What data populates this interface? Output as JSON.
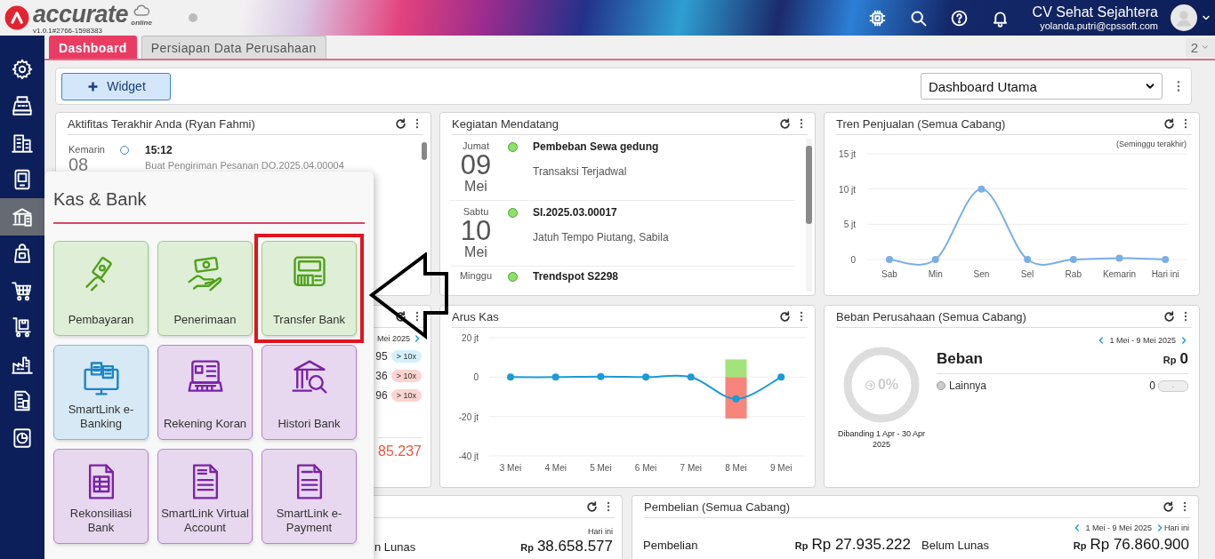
{
  "header": {
    "logo_text": "accurate",
    "logo_subtext": "online",
    "version": "v1.0.1#2766-1598383",
    "company": "CV Sehat Sejahtera",
    "email": "yolanda.putri@cpssoft.com"
  },
  "sidebar": {
    "items": [
      {
        "selected": false
      },
      {
        "selected": false
      },
      {
        "selected": false
      },
      {
        "selected": false
      },
      {
        "selected": true
      },
      {
        "selected": false
      },
      {
        "selected": false
      },
      {
        "selected": false
      },
      {
        "selected": false
      },
      {
        "selected": false
      },
      {
        "selected": false
      }
    ]
  },
  "tabs": [
    {
      "label": "Dashboard",
      "selected": true
    },
    {
      "label": "Persiapan Data Perusahaan",
      "selected": false
    }
  ],
  "tab_count": "2",
  "toolbar": {
    "widget_button": "Widget",
    "dashboard_select": "Dashboard Utama"
  },
  "activity": {
    "title": "Aktifitas Terakhir Anda (Ryan Fahmi)",
    "day": "Kemarin",
    "date": "08",
    "time": "15:12",
    "description": "Buat Pengiriman Pesanan DO.2025.04.00004"
  },
  "upcoming": {
    "title": "Kegiatan Mendatang",
    "events": [
      {
        "day": "Jumat",
        "date": "09",
        "month": "Mei",
        "title": "Pembeban Sewa gedung",
        "subtitle": "Transaksi Terjadwal"
      },
      {
        "day": "Sabtu",
        "date": "10",
        "month": "Mei",
        "title": "SI.2025.03.00017",
        "subtitle": "Jatuh Tempo Piutang, Sabila"
      },
      {
        "day": "Minggu",
        "title": "Trendspot S2298"
      }
    ]
  },
  "sales_trend": {
    "title": "Tren Penjualan (Semua Cabang)",
    "period": "(Seminggu terakhir)",
    "chart_data": {
      "type": "line",
      "categories": [
        "Sab",
        "Min",
        "Sen",
        "Sel",
        "Rab",
        "Kemarin",
        "Hari ini"
      ],
      "ylim": [
        0,
        15
      ],
      "yticks": [
        {
          "value": 0,
          "label": "0"
        },
        {
          "value": 5,
          "label": "5 jt"
        },
        {
          "value": 10,
          "label": "10 jt"
        },
        {
          "value": 15,
          "label": "15 jt"
        }
      ],
      "series": [
        {
          "color": "#7aaee6",
          "marker": "circle",
          "values": [
            0,
            0,
            10,
            0,
            0,
            0.2,
            0
          ]
        }
      ]
    }
  },
  "partial_widget": {
    "period": "Mei 2025",
    "rows": [
      {
        "value": "95",
        "badge": "> 10x",
        "color": "#d3f1fb"
      },
      {
        "value": "36",
        "badge": "> 10x",
        "color": "#fbd3cf"
      },
      {
        "value": "96",
        "badge": "> 10x",
        "color": "#fbd3cf"
      }
    ],
    "total": "85.237"
  },
  "cash_flow": {
    "title": "Arus Kas",
    "chart_data": {
      "type": "line",
      "categories": [
        "3 Mei",
        "4 Mei",
        "5 Mei",
        "6 Mei",
        "7 Mei",
        "8 Mei",
        "9 Mei"
      ],
      "ylim": [
        -40,
        20
      ],
      "yticks": [
        {
          "value": -40,
          "label": "-40 jt"
        },
        {
          "value": -20,
          "label": "-20 jt"
        },
        {
          "value": 0,
          "label": "0"
        },
        {
          "value": 20,
          "label": "20 jt"
        }
      ],
      "series": [
        {
          "type": "bar",
          "color": "#a4e27c",
          "values": [
            null,
            null,
            null,
            null,
            null,
            9,
            null
          ]
        },
        {
          "type": "bar",
          "color": "#f8857b",
          "values": [
            null,
            null,
            null,
            null,
            null,
            -21,
            null
          ]
        },
        {
          "color": "#1a9bd7",
          "marker": "circle",
          "values": [
            0,
            0,
            0.3,
            0,
            0,
            -11,
            0
          ]
        }
      ]
    }
  },
  "expenses": {
    "title": "Beban Perusahaan (Semua Cabang)",
    "date_range": "1 Mei - 9 Mei 2025",
    "percent": "0%",
    "level": 0,
    "comparison": "Dibanding 1 Apr - 30 Apr 2025",
    "label": "Beban",
    "currency": "Rp",
    "amount": "0",
    "items": [
      {
        "name": "Lainnya",
        "amount": "0",
        "change": "-"
      }
    ]
  },
  "bottom_left": {
    "date_label": "Hari ini",
    "label": "n Lunas",
    "currency": "Rp",
    "amount": "38.658.577"
  },
  "purchases": {
    "title": "Pembelian (Semua Cabang)",
    "date_range": "1 Mei - 9 Mei 2025",
    "date_label": "Hari ini",
    "stats": [
      {
        "label": "Pembelian",
        "currency": "Rp",
        "amount": "Rp 27.935.222"
      },
      {
        "label": "Belum Lunas",
        "currency": "Rp",
        "amount": "Rp 76.860.900"
      }
    ]
  },
  "popup": {
    "title": "Kas & Bank",
    "tiles": [
      {
        "label": "Pembayaran",
        "color": "#4ea21a",
        "highlighted": false
      },
      {
        "label": "Penerimaan",
        "color": "#4ea21a",
        "highlighted": false
      },
      {
        "label": "Transfer Bank",
        "color": "#4ea21a",
        "highlighted": true
      },
      {
        "label": "SmartLink e-Banking",
        "color": "#1a84c7",
        "highlighted": false
      },
      {
        "label": "Rekening Koran",
        "color": "#7a23a6",
        "highlighted": false
      },
      {
        "label": "Histori Bank",
        "color": "#7a23a6",
        "highlighted": false
      },
      {
        "label": "Rekonsiliasi Bank",
        "color": "#7a23a6",
        "highlighted": false
      },
      {
        "label": "SmartLink Virtual Account",
        "color": "#7a23a6",
        "highlighted": false
      },
      {
        "label": "SmartLink e-Payment",
        "color": "#7a23a6",
        "highlighted": false
      }
    ]
  }
}
